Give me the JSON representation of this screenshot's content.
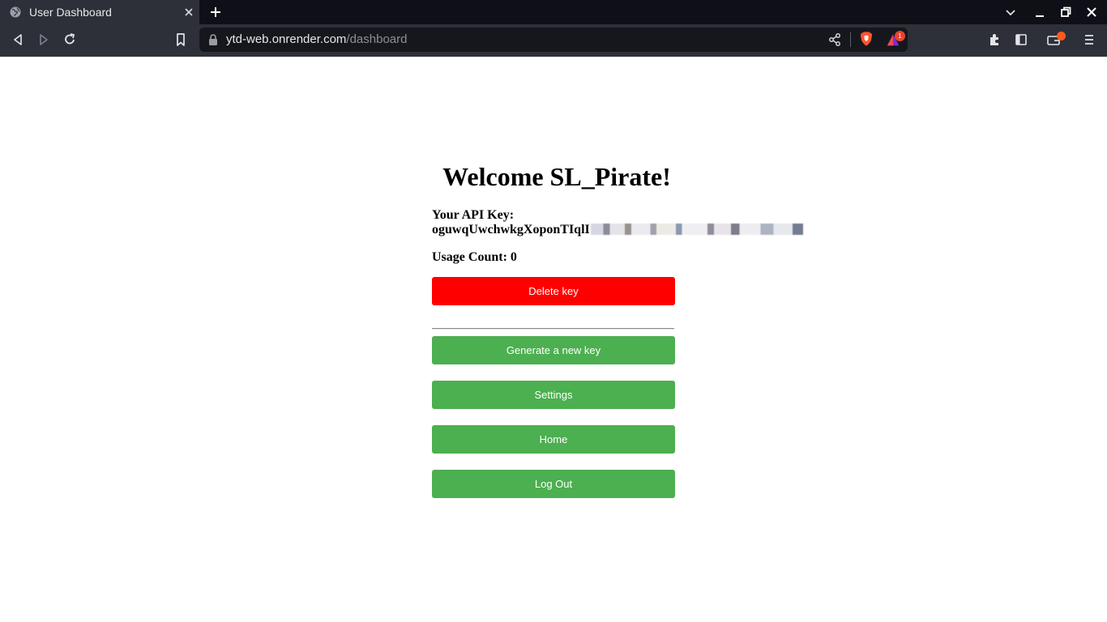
{
  "browser": {
    "tab_title": "User Dashboard",
    "url_host": "ytd-web.onrender.com",
    "url_path": "/dashboard",
    "rewards_badge": "1",
    "accent_color": "#ff5a1f"
  },
  "page": {
    "welcome": "Welcome SL_Pirate!",
    "api_key_label": "Your API Key:",
    "api_key_visible": "oguwqUwchwkgXoponTIqlI",
    "usage_label": "Usage Count:",
    "usage_value": "0",
    "buttons": {
      "delete": "Delete key",
      "generate": "Generate a new key",
      "settings": "Settings",
      "home": "Home",
      "logout": "Log Out"
    },
    "colors": {
      "danger": "#ff0000",
      "primary": "#4caf50"
    }
  }
}
